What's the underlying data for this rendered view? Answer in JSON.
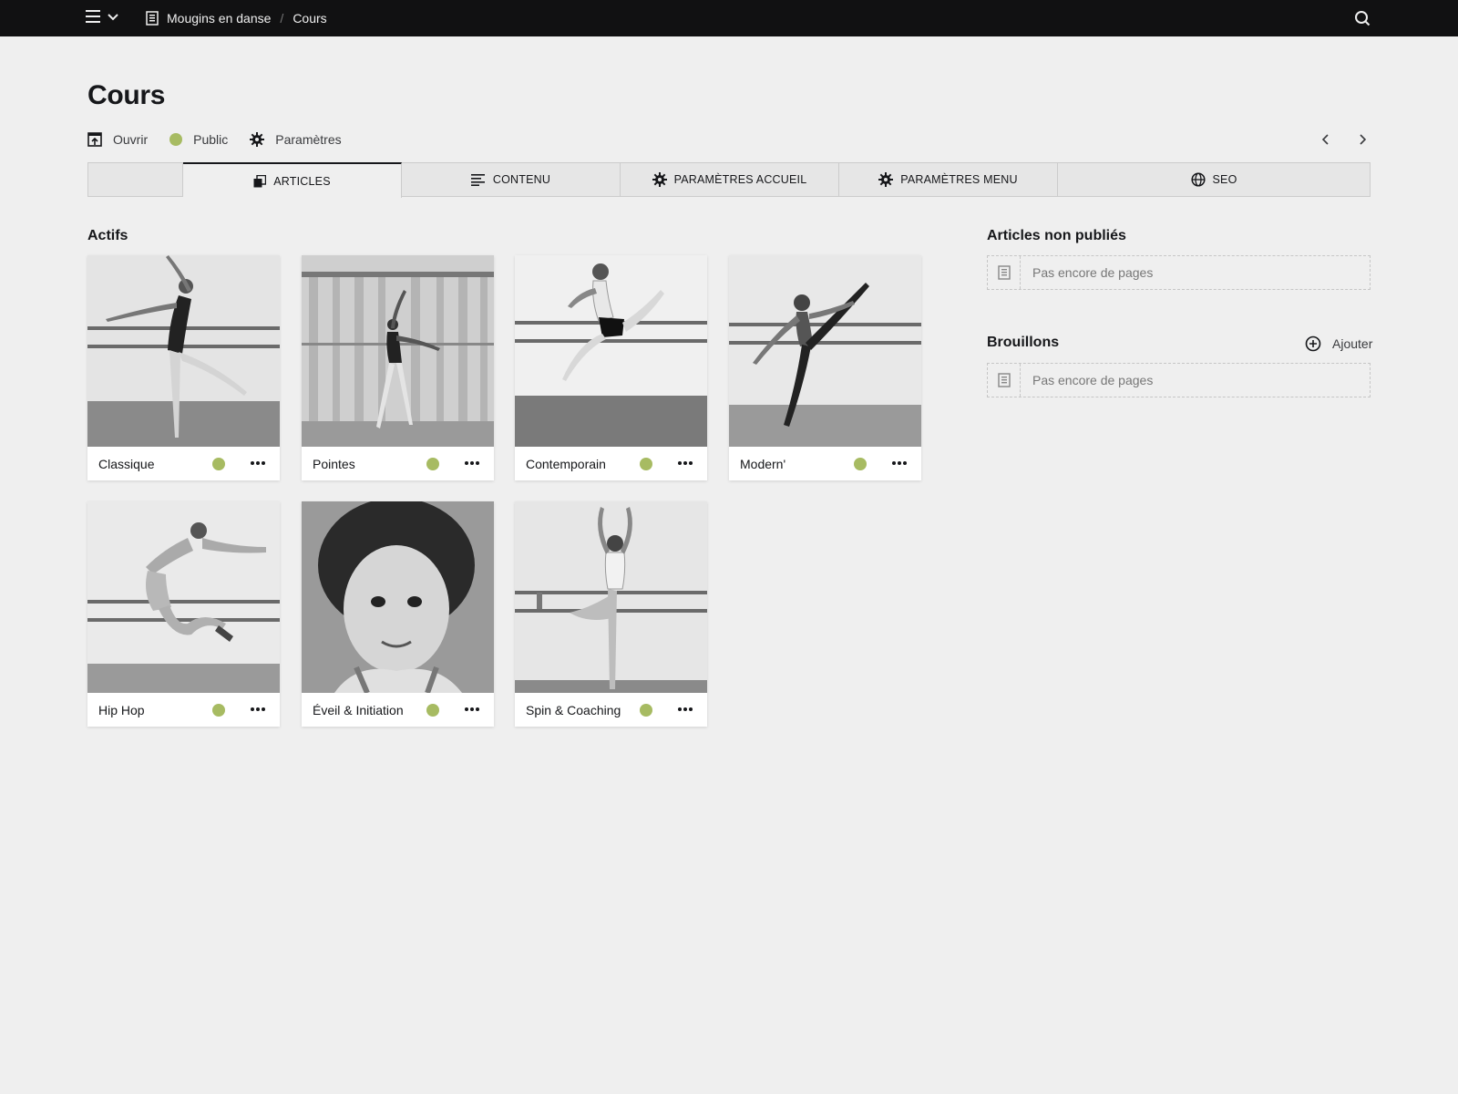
{
  "topbar": {
    "breadcrumbs": [
      "Mougins en danse",
      "Cours"
    ],
    "icons": [
      "menu-icon",
      "chevron-down-icon",
      "page-icon",
      "search-icon"
    ]
  },
  "page": {
    "title": "Cours"
  },
  "actions": {
    "open_label": "Ouvrir",
    "status_label": "Public",
    "settings_label": "Paramètres"
  },
  "tabs": [
    "ARTICLES",
    "CONTENU",
    "PARAMÈTRES ACCUEIL",
    "PARAMÈTRES MENU",
    "SEO"
  ],
  "active_tab": "ARTICLES",
  "sections": {
    "active_title": "Actifs",
    "unpublished_title": "Articles non publiés",
    "drafts_title": "Brouillons",
    "add_label": "Ajouter",
    "empty_text": "Pas encore de pages"
  },
  "cards": [
    {
      "name": "Classique",
      "status": "public"
    },
    {
      "name": "Pointes",
      "status": "public"
    },
    {
      "name": "Contemporain",
      "status": "public"
    },
    {
      "name": "Modern'",
      "status": "public"
    },
    {
      "name": "Hip Hop",
      "status": "public"
    },
    {
      "name": "Éveil & Initiation",
      "status": "public"
    },
    {
      "name": "Spin & Coaching",
      "status": "public"
    }
  ],
  "colors": {
    "topbar": "#111112",
    "background": "#efefef",
    "status_public": "#a7bb62",
    "text": "#16171a"
  }
}
